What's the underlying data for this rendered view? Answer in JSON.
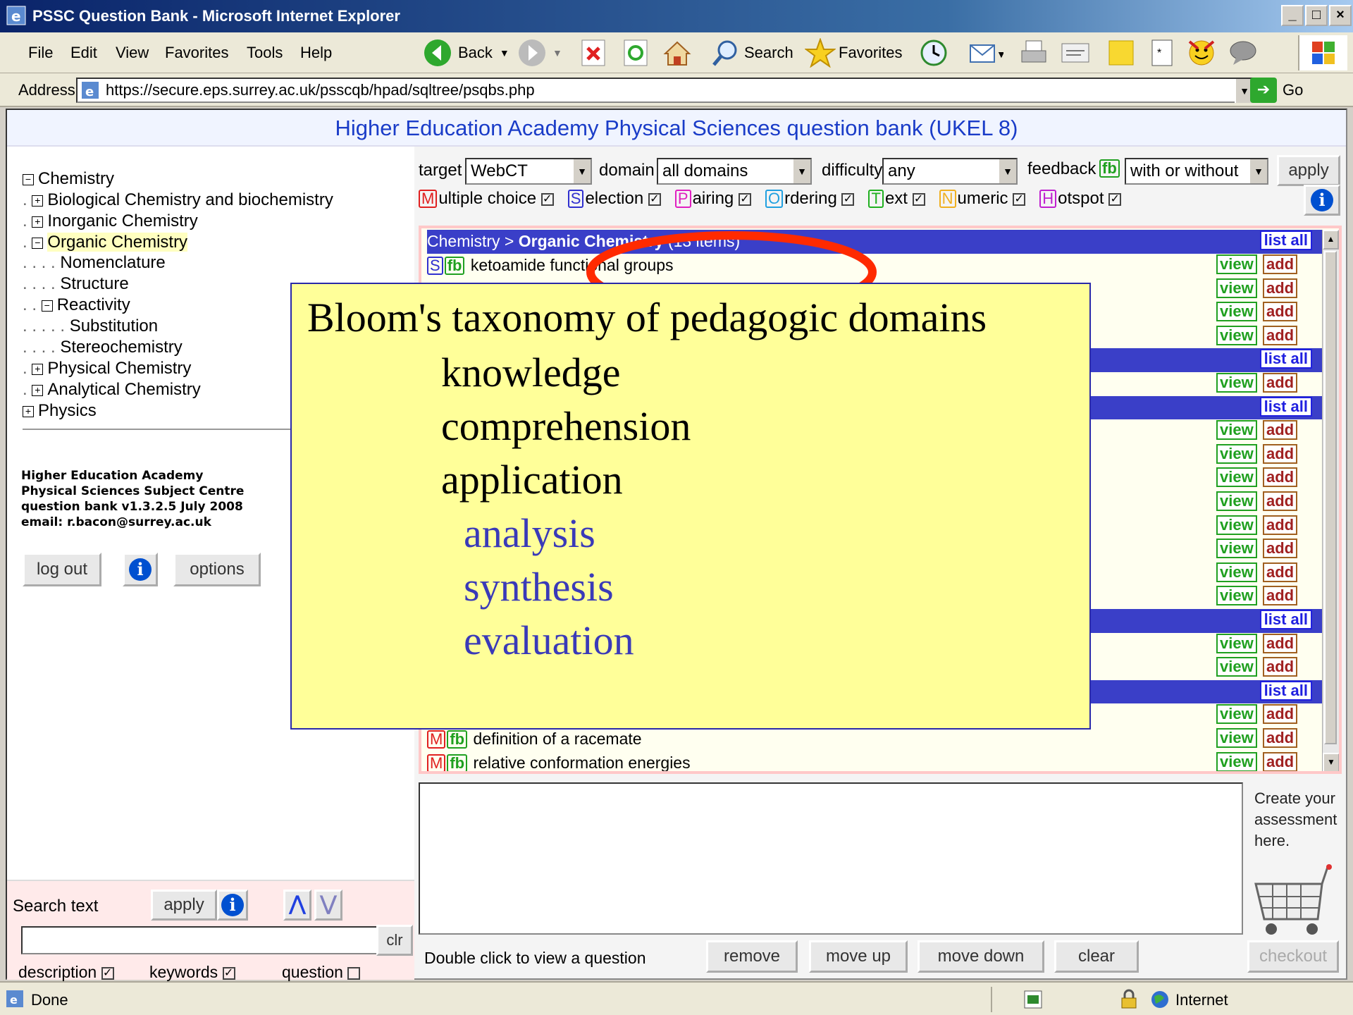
{
  "window": {
    "title": "PSSC Question Bank - Microsoft Internet Explorer"
  },
  "menu": [
    "File",
    "Edit",
    "View",
    "Favorites",
    "Tools",
    "Help"
  ],
  "toolbar": {
    "back": "Back",
    "search": "Search",
    "favorites": "Favorites"
  },
  "address": {
    "label": "Address",
    "url": "https://secure.eps.surrey.ac.uk/psscqb/hpad/sqltree/psqbs.php",
    "go": "Go"
  },
  "header": {
    "title": "Higher Education Academy Physical Sciences question bank  (UKEL 8)"
  },
  "tree": {
    "items": [
      "Chemistry",
      "Biological Chemistry and biochemistry",
      "Inorganic Chemistry",
      "Organic Chemistry",
      "Nomenclature",
      "Structure",
      "Reactivity",
      "Substitution",
      "Stereochemistry",
      "Physical Chemistry",
      "Analytical Chemistry",
      "Physics"
    ]
  },
  "footer_info": {
    "line1": "Higher Education Academy",
    "line2": "Physical Sciences Subject Centre",
    "line3": "question bank v1.3.2.5 July 2008",
    "line4": "email: r.bacon@surrey.ac.uk"
  },
  "left_buttons": {
    "logout": "log out",
    "options": "options"
  },
  "search": {
    "label": "Search text",
    "apply": "apply",
    "clr": "clr",
    "value": "",
    "description": "description",
    "keywords": "keywords",
    "question": "question"
  },
  "filters": {
    "target_label": "target",
    "target_value": "WebCT",
    "domain_label": "domain",
    "domain_value": "all domains",
    "difficulty_label": "difficulty",
    "difficulty_value": "any",
    "feedback_label": "feedback",
    "fb_badge": "fb",
    "feedback_value": "with or without",
    "apply": "apply"
  },
  "types": [
    {
      "letter": "M",
      "rest": "ultiple choice",
      "color": "#e02020"
    },
    {
      "letter": "S",
      "rest": "election",
      "color": "#3030d0"
    },
    {
      "letter": "P",
      "rest": "airing",
      "color": "#e020c0"
    },
    {
      "letter": "O",
      "rest": "rdering",
      "color": "#20a0e0"
    },
    {
      "letter": "T",
      "rest": "ext",
      "color": "#20b020"
    },
    {
      "letter": "N",
      "rest": "umeric",
      "color": "#f0b020"
    },
    {
      "letter": "H",
      "rest": "otspot",
      "color": "#c020d0"
    }
  ],
  "list": {
    "header_path": "Chemistry > ",
    "header_bold": "Organic Chemistry",
    "header_count": " (13 items)",
    "list_all": "list all",
    "view": "view",
    "add": "add",
    "fb": "fb",
    "rows_visible": [
      {
        "type": "S",
        "text": "ketoamide functional groups"
      },
      {
        "type": "M",
        "text": "definition of a racemate"
      },
      {
        "type": "M",
        "text": "relative conformation energies"
      }
    ]
  },
  "overlay": {
    "title": "Bloom's taxonomy of pedagogic domains",
    "lower": [
      "knowledge",
      "comprehension",
      "application"
    ],
    "higher": [
      "analysis",
      "synthesis",
      "evaluation"
    ]
  },
  "assessment": {
    "hint": "Double click to view a question",
    "remove": "remove",
    "move_up": "move up",
    "move_down": "move down",
    "clear": "clear",
    "create": "Create your assessment here.",
    "checkout": "checkout"
  },
  "status": {
    "text": "Done",
    "zone": "Internet"
  }
}
